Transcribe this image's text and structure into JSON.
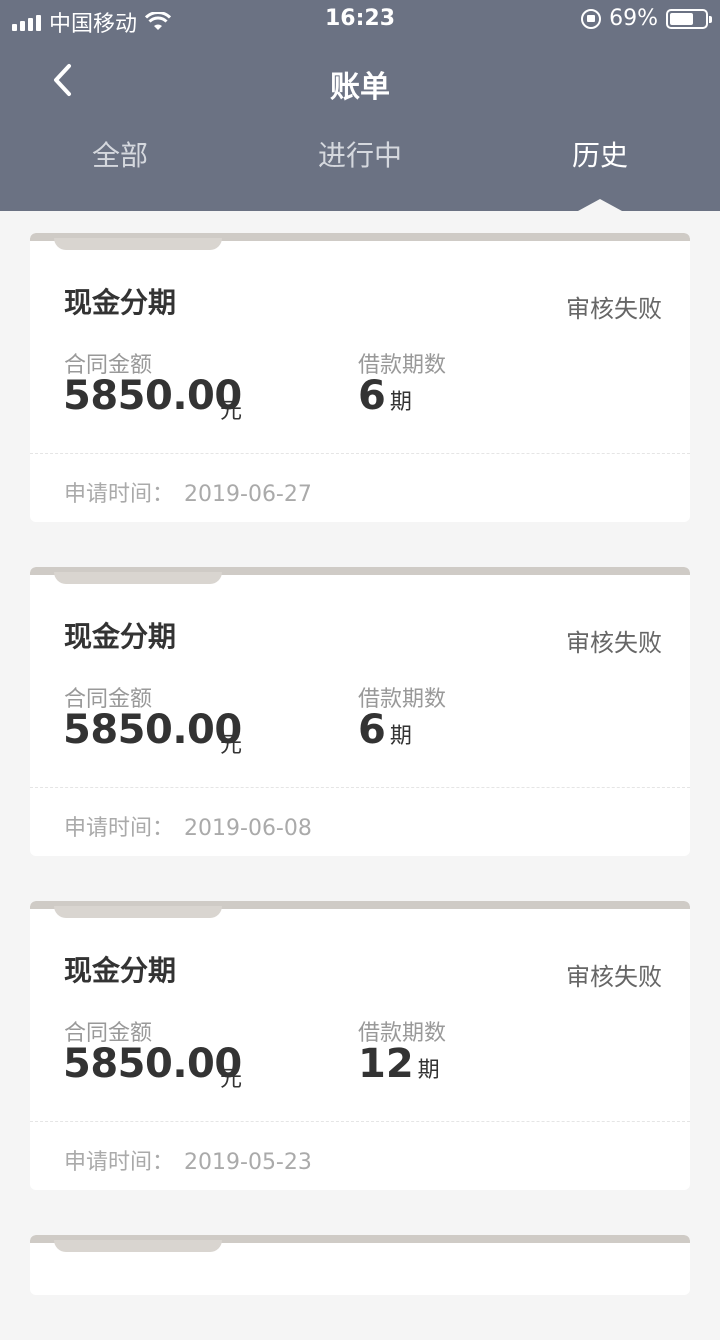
{
  "status_bar": {
    "carrier": "中国移动",
    "time": "16:23",
    "battery": "69%",
    "battery_level": 0.69
  },
  "navbar": {
    "title": "账单",
    "back_icon": "chevron-left-icon"
  },
  "tabs": [
    {
      "label": "全部",
      "active": false
    },
    {
      "label": "进行中",
      "active": false
    },
    {
      "label": "历史",
      "active": true
    }
  ],
  "bills": [
    {
      "title": "现金分期",
      "status": "审核失败",
      "amount_label": "合同金额",
      "amount": "5850.00",
      "amount_unit": "元",
      "term_label": "借款期数",
      "term": "6",
      "term_unit": "期",
      "apply_label": "申请时间：",
      "apply_date": "2019-06-27"
    },
    {
      "title": "现金分期",
      "status": "审核失败",
      "amount_label": "合同金额",
      "amount": "5850.00",
      "amount_unit": "元",
      "term_label": "借款期数",
      "term": "6",
      "term_unit": "期",
      "apply_label": "申请时间：",
      "apply_date": "2019-06-08"
    },
    {
      "title": "现金分期",
      "status": "审核失败",
      "amount_label": "合同金额",
      "amount": "5850.00",
      "amount_unit": "元",
      "term_label": "借款期数",
      "term": "12",
      "term_unit": "期",
      "apply_label": "申请时间：",
      "apply_date": "2019-05-23"
    }
  ],
  "colors": {
    "header_bg": "#6b7283",
    "page_bg": "#f5f5f5",
    "card_bg": "#ffffff"
  }
}
